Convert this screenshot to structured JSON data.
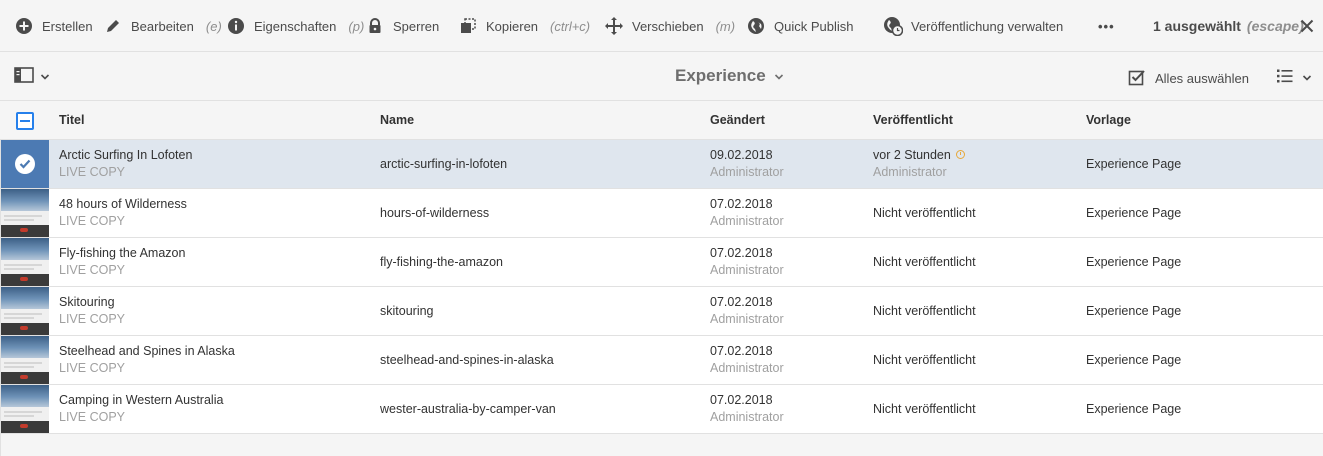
{
  "actionbar": {
    "actions": [
      {
        "label": "Erstellen",
        "shortcut": "",
        "icon": "add-circle-icon"
      },
      {
        "label": "Bearbeiten",
        "shortcut": "(e)",
        "icon": "edit-icon"
      },
      {
        "label": "Eigenschaften",
        "shortcut": "(p)",
        "icon": "info-icon"
      },
      {
        "label": "Sperren",
        "shortcut": "",
        "icon": "lock-icon"
      },
      {
        "label": "Kopieren",
        "shortcut": "(ctrl+c)",
        "icon": "copy-icon"
      },
      {
        "label": "Verschieben",
        "shortcut": "(m)",
        "icon": "move-icon"
      },
      {
        "label": "Quick Publish",
        "shortcut": "",
        "icon": "globe-icon"
      },
      {
        "label": "Veröffentlichung verwalten",
        "shortcut": "",
        "icon": "globe-clock-icon"
      }
    ],
    "more": "•••",
    "selection": {
      "count_label": "1 ausgewählt",
      "shortcut": "(escape)"
    }
  },
  "subheader": {
    "title": "Experience",
    "select_all": "Alles auswählen"
  },
  "table": {
    "columns": [
      "Titel",
      "Name",
      "Geändert",
      "Veröffentlicht",
      "Vorlage"
    ],
    "rows": [
      {
        "title": "Arctic Surfing In Lofoten",
        "subtitle": "LIVE COPY",
        "name": "arctic-surfing-in-lofoten",
        "modified": "09.02.2018",
        "modified_by": "Administrator",
        "published": "vor 2 Stunden",
        "published_by": "Administrator",
        "template": "Experience Page",
        "selected": true
      },
      {
        "title": "48 hours of Wilderness",
        "subtitle": "LIVE COPY",
        "name": "hours-of-wilderness",
        "modified": "07.02.2018",
        "modified_by": "Administrator",
        "published": "Nicht veröffentlicht",
        "published_by": "",
        "template": "Experience Page",
        "selected": false
      },
      {
        "title": "Fly-fishing the Amazon",
        "subtitle": "LIVE COPY",
        "name": "fly-fishing-the-amazon",
        "modified": "07.02.2018",
        "modified_by": "Administrator",
        "published": "Nicht veröffentlicht",
        "published_by": "",
        "template": "Experience Page",
        "selected": false
      },
      {
        "title": "Skitouring",
        "subtitle": "LIVE COPY",
        "name": "skitouring",
        "modified": "07.02.2018",
        "modified_by": "Administrator",
        "published": "Nicht veröffentlicht",
        "published_by": "",
        "template": "Experience Page",
        "selected": false
      },
      {
        "title": "Steelhead and Spines in Alaska",
        "subtitle": "LIVE COPY",
        "name": "steelhead-and-spines-in-alaska",
        "modified": "07.02.2018",
        "modified_by": "Administrator",
        "published": "Nicht veröffentlicht",
        "published_by": "",
        "template": "Experience Page",
        "selected": false
      },
      {
        "title": "Camping in Western Australia",
        "subtitle": "LIVE COPY",
        "name": "wester-australia-by-camper-van",
        "modified": "07.02.2018",
        "modified_by": "Administrator",
        "published": "Nicht veröffentlicht",
        "published_by": "",
        "template": "Experience Page",
        "selected": false
      }
    ]
  },
  "colors": {
    "accent": "#2680eb",
    "selected_row": "#dfe6ee",
    "pending_clock": "#e7a83a"
  }
}
